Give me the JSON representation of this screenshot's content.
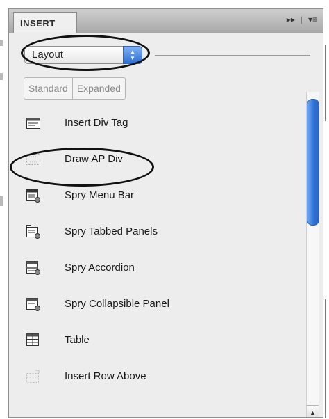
{
  "panel": {
    "tab_label": "INSERT",
    "controls": {
      "expand": "▸▸",
      "separator": "|",
      "menu": "▾≡"
    }
  },
  "category_select": {
    "value": "Layout"
  },
  "view_toggle": {
    "standard": "Standard",
    "expanded": "Expanded"
  },
  "items": [
    {
      "label": "Insert Div Tag",
      "icon": "div-tag-icon"
    },
    {
      "label": "Draw AP Div",
      "icon": "ap-div-icon"
    },
    {
      "label": "Spry Menu Bar",
      "icon": "spry-menu-bar-icon"
    },
    {
      "label": "Spry Tabbed Panels",
      "icon": "spry-tabbed-panels-icon"
    },
    {
      "label": "Spry Accordion",
      "icon": "spry-accordion-icon"
    },
    {
      "label": "Spry Collapsible Panel",
      "icon": "spry-collapsible-panel-icon"
    },
    {
      "label": "Table",
      "icon": "table-icon"
    },
    {
      "label": "Insert Row Above",
      "icon": "insert-row-above-icon"
    }
  ],
  "scrollbar": {
    "up": "▲",
    "down": "▼"
  },
  "colors": {
    "accent": "#2f74d8",
    "panel_bg": "#ededed",
    "annotation": "#111111"
  }
}
